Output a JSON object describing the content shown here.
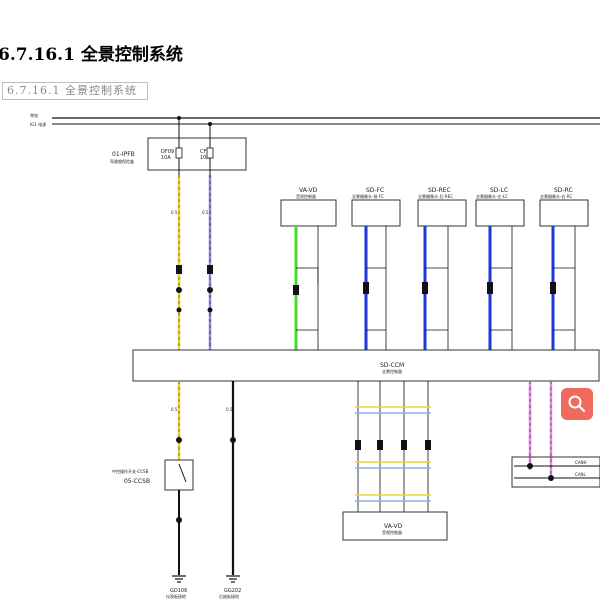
{
  "page": {
    "heading": "6.7.16.1  全景控制系统",
    "subheading": "6.7.16.1  全景控制系统"
  },
  "rails": {
    "top1": "常电",
    "top2": "IG1 电源"
  },
  "fuse_block": {
    "name": "01-IPFB",
    "desc": "驾驶舱保险盒",
    "fuse1_id": "DF09",
    "fuse1_rating": "10A",
    "fuse2_id": "CF50",
    "fuse2_rating": "10A"
  },
  "modules": {
    "va_top": {
      "id": "VA-VD",
      "desc": "音视控制器"
    },
    "sd_fc": {
      "id": "SD-FC",
      "desc": "全景摄像头-前-FC"
    },
    "sd_rec": {
      "id": "SD-REC",
      "desc": "全景摄像头-后-REC"
    },
    "sd_lc": {
      "id": "SD-LC",
      "desc": "全景摄像头-左-LC"
    },
    "sd_rc": {
      "id": "SD-RC",
      "desc": "全景摄像头-右-RC"
    },
    "ccm": {
      "id": "SD-CCM",
      "desc": "全景控制器"
    },
    "switch": {
      "desc": "中控操作开关-CCSB",
      "id": "05-CCSB"
    },
    "va_bottom": {
      "id": "VA-VD",
      "desc": "音视控制器"
    }
  },
  "wire_labels": {
    "w1": "0.5",
    "w2": "0.5",
    "w3": "0.5",
    "w4": "0.5"
  },
  "can": {
    "high": "CANH",
    "low": "CANL"
  },
  "grounds": {
    "g1_id": "GD106",
    "g1_desc": "仪表板接地",
    "g2_id": "GG202",
    "g2_desc": "后座板接地"
  },
  "colors": {
    "yellow_wire": "#f2d23a",
    "purple_wire": "#8f86d6",
    "green_wire": "#44dd22",
    "blue_wire": "#1f36d8",
    "black_wire": "#111111",
    "pink_wire": "#e58adf",
    "search_button": "#ef6b5e"
  },
  "icons": {
    "search": "search-icon"
  }
}
